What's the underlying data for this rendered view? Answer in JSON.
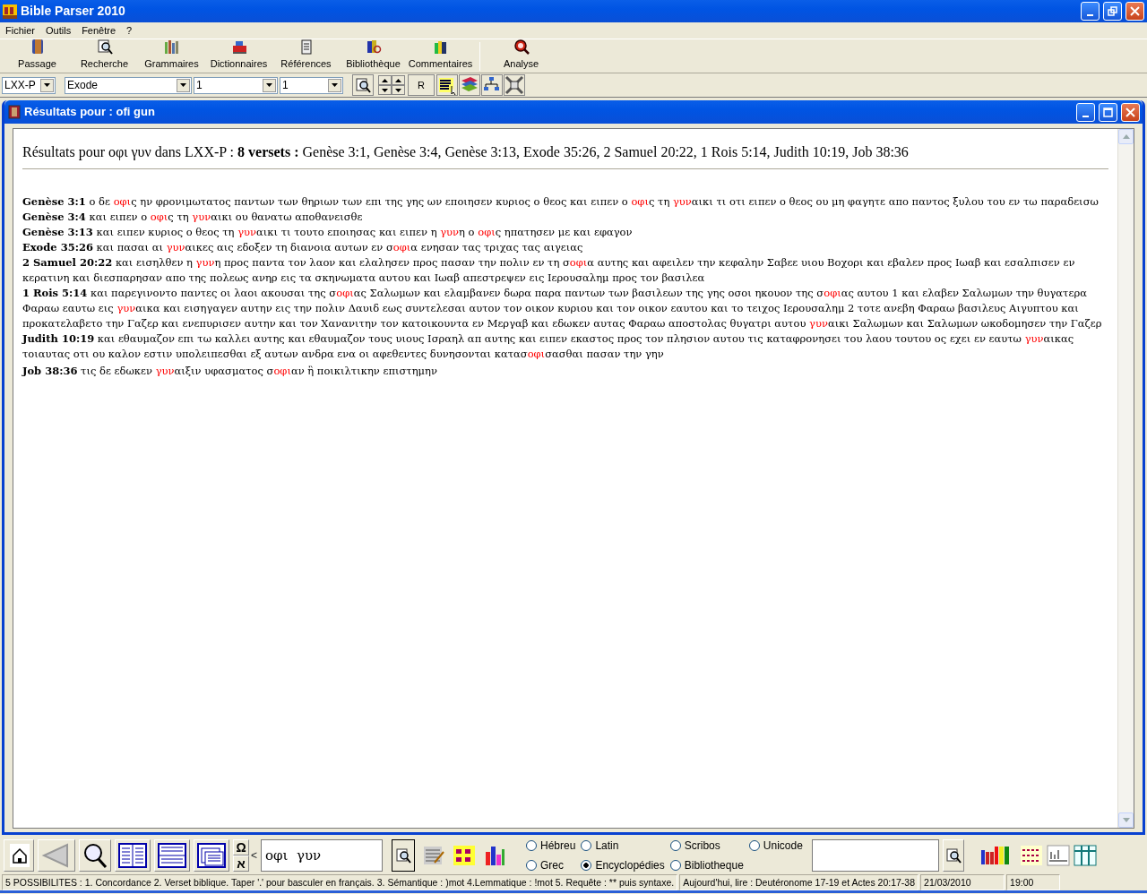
{
  "window": {
    "title": "Bible Parser 2010"
  },
  "menu": [
    "Fichier",
    "Outils",
    "Fenêtre",
    "?"
  ],
  "toolbar": [
    "Passage",
    "Recherche",
    "Grammaires",
    "Dictionnaires",
    "Références",
    "Bibliothèque",
    "Commentaires",
    "Analyse"
  ],
  "selectors": [
    {
      "value": "LXX-P"
    },
    {
      "value": "Exode"
    },
    {
      "value": "1"
    },
    {
      "value": "1"
    }
  ],
  "r_button": "R",
  "child_window": {
    "title": "Résultats pour : ofi gun"
  },
  "results": {
    "heading": "Résultats pour οφι  γυν dans LXX-P : **8 versets :** Genèse 3:1, Genèse 3:4, Genèse 3:13, Exode 35:26, 2 Samuel 20:22, 1 Rois 5:14, Judith 10:19, Job 38:36",
    "verses": [
      {
        "reference": "Genèse 3:1",
        "segments": [
          {
            "text": "ο δε ",
            "highlight": false
          },
          {
            "text": "οφι",
            "highlight": true
          },
          {
            "text": "ς ην φρονιμωτατος παντων των θηριων των επι της γης ων εποιησεν κυριος ο θεος και ειπεν ο ",
            "highlight": false
          },
          {
            "text": "οφι",
            "highlight": true
          },
          {
            "text": "ς τη ",
            "highlight": false
          },
          {
            "text": "γυν",
            "highlight": true
          },
          {
            "text": "αικι τι οτι ειπεν ο θεος ου μη φαγητε απο παντος ξυλου του εν τω παραδεισω",
            "highlight": false
          }
        ]
      },
      {
        "reference": "Genèse 3:4",
        "segments": [
          {
            "text": "και ειπεν ο ",
            "highlight": false
          },
          {
            "text": "οφι",
            "highlight": true
          },
          {
            "text": "ς τη ",
            "highlight": false
          },
          {
            "text": "γυν",
            "highlight": true
          },
          {
            "text": "αικι ου θανατω αποθανεισθε",
            "highlight": false
          }
        ]
      },
      {
        "reference": "Genèse 3:13",
        "segments": [
          {
            "text": "και ειπεν κυριος ο θεος τη ",
            "highlight": false
          },
          {
            "text": "γυν",
            "highlight": true
          },
          {
            "text": "αικι τι τουτο εποιησας και ειπεν η ",
            "highlight": false
          },
          {
            "text": "γυν",
            "highlight": true
          },
          {
            "text": "η ο ",
            "highlight": false
          },
          {
            "text": "οφι",
            "highlight": true
          },
          {
            "text": "ς ηπατησεν με και εφαγον",
            "highlight": false
          }
        ]
      },
      {
        "reference": "Exode 35:26",
        "segments": [
          {
            "text": "και πασαι αι ",
            "highlight": false
          },
          {
            "text": "γυν",
            "highlight": true
          },
          {
            "text": "αικες αις εδοξεν τη διανοια αυτων εν σ",
            "highlight": false
          },
          {
            "text": "οφι",
            "highlight": true
          },
          {
            "text": "α ενησαν τας τριχας τας αιγειας",
            "highlight": false
          }
        ]
      },
      {
        "reference": "2 Samuel 20:22",
        "segments": [
          {
            "text": "και εισηλθεν η ",
            "highlight": false
          },
          {
            "text": "γυν",
            "highlight": true
          },
          {
            "text": "η προς παντα τον λαον και ελαλησεν προς πασαν την πολιν εν τη σ",
            "highlight": false
          },
          {
            "text": "οφι",
            "highlight": true
          },
          {
            "text": "α αυτης και αφειλεν την κεφαλην Σαβεε υιου Βοχορι και εβαλεν προς Ιωαβ και εσαλπισεν εν κερατινη και διεσπαρησαν απο της πολεως ανηρ εις τα σκηνωματα αυτου και Ιωαβ απεστρεψεν εις Ιερουσαλημ προς τον βασιλεα",
            "highlight": false
          }
        ]
      },
      {
        "reference": "1 Rois 5:14",
        "segments": [
          {
            "text": "και παρεγινοντο παντες οι λαοι ακουσαι της σ",
            "highlight": false
          },
          {
            "text": "οφι",
            "highlight": true
          },
          {
            "text": "ας Σαλωμων και ελαμβανεν δωρα παρα παντων των βασιλεων της γης οσοι ηκουον της σ",
            "highlight": false
          },
          {
            "text": "οφι",
            "highlight": true
          },
          {
            "text": "ας αυτου 1 και ελαβεν Σαλωμων την θυγατερα Φαραω εαυτω εις ",
            "highlight": false
          },
          {
            "text": "γυν",
            "highlight": true
          },
          {
            "text": "αικα και εισηγαγεν αυτην εις την πολιν Δαυιδ εως συντελεσαι αυτον τον οικον κυριου και τον οικον εαυτου και το τειχος Ιερουσαλημ 2 τοτε ανεβη Φαραω βασιλευς Αιγυπτου και προκατελαβετο την Γαζερ και ενεπυρισεν αυτην και τον Χανανιτην τον κατοικουντα εν Μεργαβ και εδωκεν αυτας Φαραω αποστολας θυγατρι αυτου ",
            "highlight": false
          },
          {
            "text": "γυν",
            "highlight": true
          },
          {
            "text": "αικι Σαλωμων και Σαλωμων ωκοδομησεν την Γαζερ",
            "highlight": false
          }
        ]
      },
      {
        "reference": "Judith 10:19",
        "segments": [
          {
            "text": "και εθαυμαζον επι τω καλλει αυτης και εθαυμαζον τους υιους Ισραηλ απ αυτης και ειπεν εκαστος προς τον πλησιον αυτου τις καταφρονησει του λαου τουτου ος εχει εν εαυτω ",
            "highlight": false
          },
          {
            "text": "γυν",
            "highlight": true
          },
          {
            "text": "αικας τοιαυτας οτι ου καλον εστιν υπολειπεσθαι εξ αυτων ανδρα ενα οι αφεθεντες δυνησονται κατασ",
            "highlight": false
          },
          {
            "text": "οφι",
            "highlight": true
          },
          {
            "text": "σασθαι πασαν την γην",
            "highlight": false
          }
        ]
      },
      {
        "reference": "Job 38:36",
        "segments": [
          {
            "text": "τις δε εδωκεν ",
            "highlight": false
          },
          {
            "text": "γυν",
            "highlight": true
          },
          {
            "text": "αιξιν υφασματος σ",
            "highlight": false
          },
          {
            "text": "οφι",
            "highlight": true
          },
          {
            "text": "αν ἢ ποικιλτικην επιστημην",
            "highlight": false
          }
        ]
      }
    ]
  },
  "bottom_bar": {
    "symbol_keys": [
      "Ω",
      "א"
    ],
    "arrow_key": "<",
    "search": {
      "value": "οφι  γυν"
    },
    "radios": [
      {
        "label": "Hébreu",
        "selected": false
      },
      {
        "label": "Latin",
        "selected": false
      },
      {
        "label": "Scribos",
        "selected": false
      },
      {
        "label": "Unicode",
        "selected": false
      },
      {
        "label": "Grec",
        "selected": false
      },
      {
        "label": "Encyclopédies",
        "selected": true
      },
      {
        "label": "Bibliotheque",
        "selected": false
      }
    ]
  },
  "status_bar": [
    "5 POSSIBILITES : 1. Concordance 2. Verset biblique. Taper '.' pour basculer en français. 3. Sémantique : )mot 4.Lemmatique : !mot 5. Requête : ** puis syntaxe.",
    "Aujourd'hui, lire : Deutéronome 17-19 et Actes 20:17-38",
    "21/03/2010",
    "19:00"
  ]
}
